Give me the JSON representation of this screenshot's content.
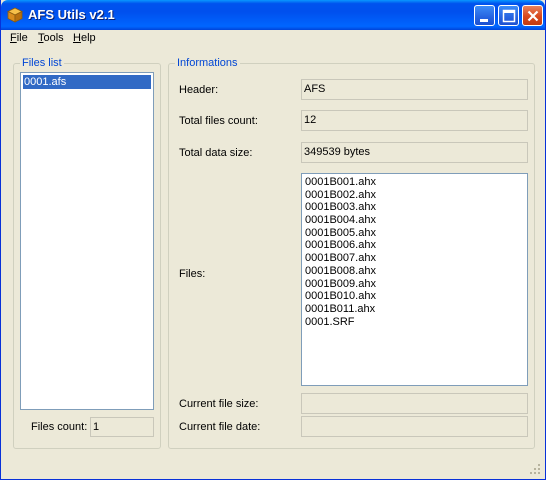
{
  "window": {
    "title": "AFS Utils v2.1"
  },
  "menu": {
    "file": {
      "first": "F",
      "rest": "ile"
    },
    "tools": {
      "first": "T",
      "rest": "ools"
    },
    "help": {
      "first": "H",
      "rest": "elp"
    }
  },
  "files_list_group": {
    "title": "Files list",
    "items": [
      "0001.afs"
    ],
    "selected": "0001.afs",
    "files_count_label": "Files count:",
    "files_count_value": "1"
  },
  "info_group": {
    "title": "Informations",
    "header_label": "Header:",
    "header_value": "AFS",
    "total_files_label": "Total files count:",
    "total_files_value": "12",
    "total_size_label": "Total data size:",
    "total_size_value": "349539 bytes",
    "files_label": "Files:",
    "files": [
      "0001B001.ahx",
      "0001B002.ahx",
      "0001B003.ahx",
      "0001B004.ahx",
      "0001B005.ahx",
      "0001B006.ahx",
      "0001B007.ahx",
      "0001B008.ahx",
      "0001B009.ahx",
      "0001B010.ahx",
      "0001B011.ahx",
      "0001.SRF"
    ],
    "current_size_label": "Current file size:",
    "current_size_value": "",
    "current_date_label": "Current file date:",
    "current_date_value": ""
  },
  "icons": {
    "app": "afs-box-icon",
    "minimize": "minimize-icon",
    "maximize": "maximize-icon",
    "close": "close-icon"
  },
  "colors": {
    "titlebar": "#0054e3",
    "selection": "#316ac5",
    "group_title": "#0046d5",
    "window_bg": "#ece9d8"
  }
}
